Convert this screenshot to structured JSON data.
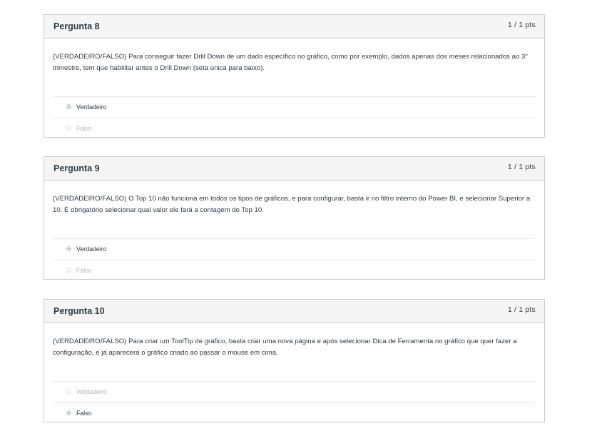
{
  "questions": [
    {
      "title": "Pergunta 8",
      "points": "1 / 1 pts",
      "text": "(VERDADEIRO/FALSO) Para conseguir fazer Drill Down de um dado específico no gráfico, como por exemplo, dados apenas dos meses relacionados ao 3° trimestre, tem que habilitar antes o Drill Down (seta única para baixo).",
      "answers": [
        {
          "label": "Verdadeiro",
          "selected": true
        },
        {
          "label": "Falso",
          "selected": false
        }
      ]
    },
    {
      "title": "Pergunta 9",
      "points": "1 / 1 pts",
      "text": "(VERDADEIRO/FALSO) O Top 10 não funciona em todos os tipos de gráficos, e para configurar, basta ir no filtro interno do Power BI, e selecionar Superior a 10. É obrigatório selecionar qual valor ele fará a contagem do Top 10.",
      "answers": [
        {
          "label": "Verdadeiro",
          "selected": true
        },
        {
          "label": "Falso",
          "selected": false
        }
      ]
    },
    {
      "title": "Pergunta 10",
      "points": "1 / 1 pts",
      "text": "(VERDADEIRO/FALSO) Para criar um ToolTip de gráfico, basta criar uma nova página e após selecionar Dica de Ferramenta no gráfico que quer fazer a configuração, e já aparecerá o gráfico criado ao passar o mouse em cima.",
      "answers": [
        {
          "label": "Verdadeiro",
          "selected": false
        },
        {
          "label": "Falso",
          "selected": true
        }
      ]
    }
  ]
}
